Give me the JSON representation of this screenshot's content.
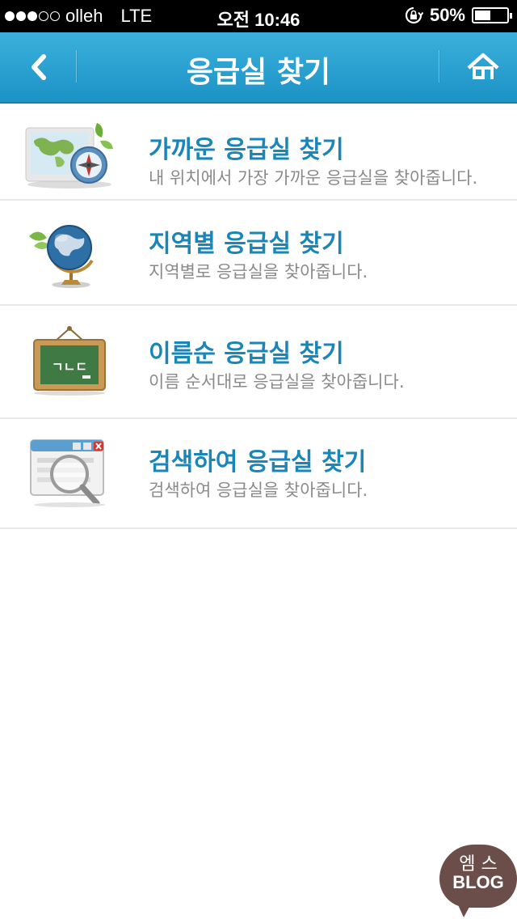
{
  "status_bar": {
    "carrier": "olleh",
    "network": "LTE",
    "time": "오전 10:46",
    "battery_percent": "50%",
    "battery_level": 0.5,
    "signal_bars_filled": 3,
    "signal_bars_total": 5
  },
  "header": {
    "title": "응급실 찾기",
    "back_icon": "chevron-left-icon",
    "home_icon": "home-icon"
  },
  "menu": {
    "items": [
      {
        "title": "가까운 응급실 찾기",
        "subtitle": "내 위치에서 가장 가까운 응급실을 찾아줍니다.",
        "icon": "map-compass-icon"
      },
      {
        "title": "지역별 응급실 찾기",
        "subtitle": "지역별로 응급실을 찾아줍니다.",
        "icon": "globe-icon"
      },
      {
        "title": "이름순 응급실 찾기",
        "subtitle": "이름 순서대로 응급실을 찾아줍니다.",
        "icon": "chalkboard-icon"
      },
      {
        "title": "검색하여 응급실 찾기",
        "subtitle": "검색하여 응급실을 찾아줍니다.",
        "icon": "search-window-icon"
      }
    ],
    "chalkboard_text": "ㄱㄴㄷ"
  },
  "watermark": {
    "line1": "엠 스",
    "line2": "BLOG"
  },
  "colors": {
    "header_bg": "#2aa3d3",
    "title_text": "#1a86b8",
    "subtitle_text": "#8a8a8a",
    "divider": "#e8e8e8"
  }
}
